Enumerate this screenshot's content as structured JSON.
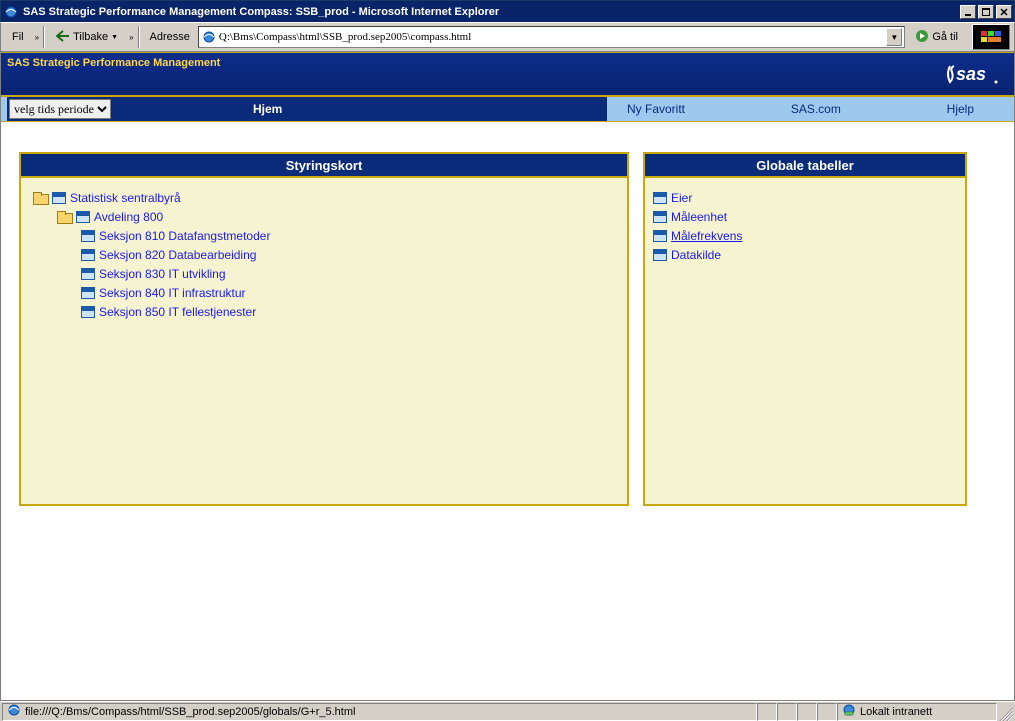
{
  "window": {
    "title": "SAS Strategic Performance Management Compass: SSB_prod - Microsoft Internet Explorer"
  },
  "toolbar": {
    "file_menu": "Fil",
    "back_label": "Tilbake",
    "address_label": "Adresse",
    "address_value": "Q:\\Bms\\Compass\\html\\SSB_prod.sep2005\\compass.html",
    "go_label": "Gå til"
  },
  "banner": {
    "title": "SAS Strategic Performance Management"
  },
  "nav": {
    "period_select": "velg tids periode",
    "home": "Hjem",
    "new_favorite": "Ny Favoritt",
    "sas_com": "SAS.com",
    "help": "Hjelp"
  },
  "panels": {
    "left_title": "Styringskort",
    "right_title": "Globale tabeller"
  },
  "tree": {
    "root": "Statistisk sentralbyrå",
    "dept": "Avdeling 800",
    "sections": [
      "Seksjon 810 Datafangstmetoder",
      "Seksjon 820 Databearbeiding",
      "Seksjon 830 IT utvikling",
      "Seksjon 840 IT infrastruktur",
      "Seksjon 850 IT fellestjenester"
    ]
  },
  "globals": {
    "items": [
      "Eier",
      "Måleenhet",
      "Målefrekvens",
      "Datakilde"
    ]
  },
  "status": {
    "url": "file:///Q:/Bms/Compass/html/SSB_prod.sep2005/globals/G+r_5.html",
    "zone": "Lokalt intranett"
  }
}
